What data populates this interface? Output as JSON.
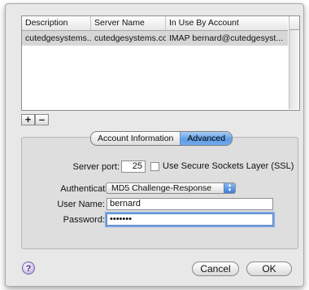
{
  "accounts_table": {
    "columns": [
      "Description",
      "Server Name",
      "In Use By Account"
    ],
    "rows": [
      {
        "description": "cutedgesystems....",
        "server_name": "cutedgesystems.com",
        "in_use_by": "IMAP bernard@cutedgesyst..."
      }
    ]
  },
  "list_controls": {
    "add_label": "+",
    "remove_label": "–"
  },
  "tabs": [
    {
      "label": "Account Information",
      "selected": false
    },
    {
      "label": "Advanced",
      "selected": true
    }
  ],
  "advanced": {
    "server_port_label": "Server port:",
    "server_port_value": "25",
    "ssl_label": "Use Secure Sockets Layer (SSL)",
    "ssl_checked": false,
    "authentication_label": "Authentication:",
    "authentication_value": "MD5 Challenge-Response",
    "username_label": "User Name:",
    "username_value": "bernard",
    "password_label": "Password:",
    "password_value": "•••••••"
  },
  "footer": {
    "help_label": "?",
    "cancel_label": "Cancel",
    "ok_label": "OK"
  },
  "colors": {
    "accent": "#5f9ee6",
    "selection": "#d6d6d6"
  }
}
